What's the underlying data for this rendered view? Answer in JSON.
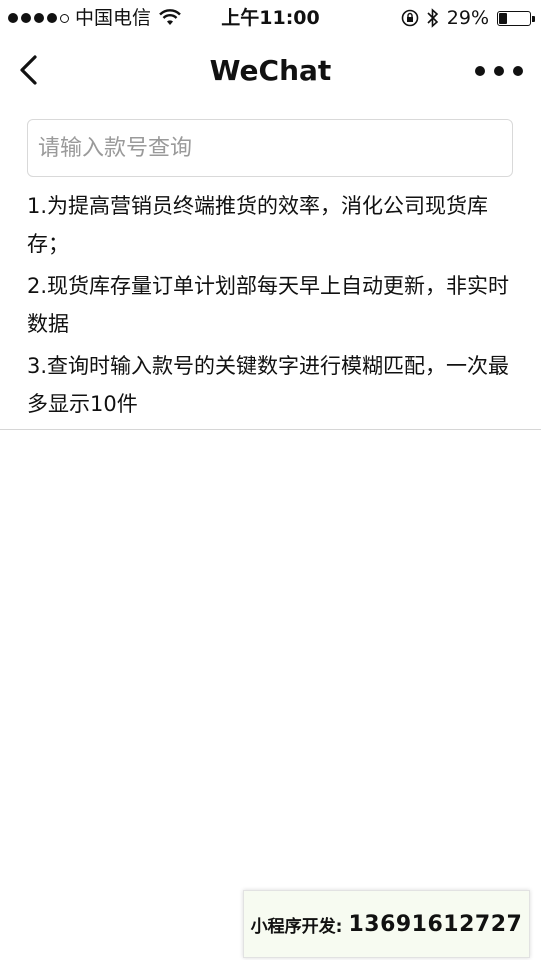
{
  "status_bar": {
    "carrier": "中国电信",
    "time": "上午11:00",
    "battery_percent_label": "29%",
    "battery_level": 0.29
  },
  "nav": {
    "title": "WeChat"
  },
  "search": {
    "placeholder": "请输入款号查询",
    "value": ""
  },
  "notes": [
    {
      "text": "1.为提高营销员终端推货的效率，消化公司现货库存；"
    },
    {
      "text": "2.现货库存量订单计划部每天早上自动更新，非实时数据"
    },
    {
      "text": "3.查询时输入款号的关键数字进行模糊匹配，一次最多显示10件"
    }
  ],
  "banner": {
    "label": "小程序开发:",
    "phone": "13691612727"
  }
}
